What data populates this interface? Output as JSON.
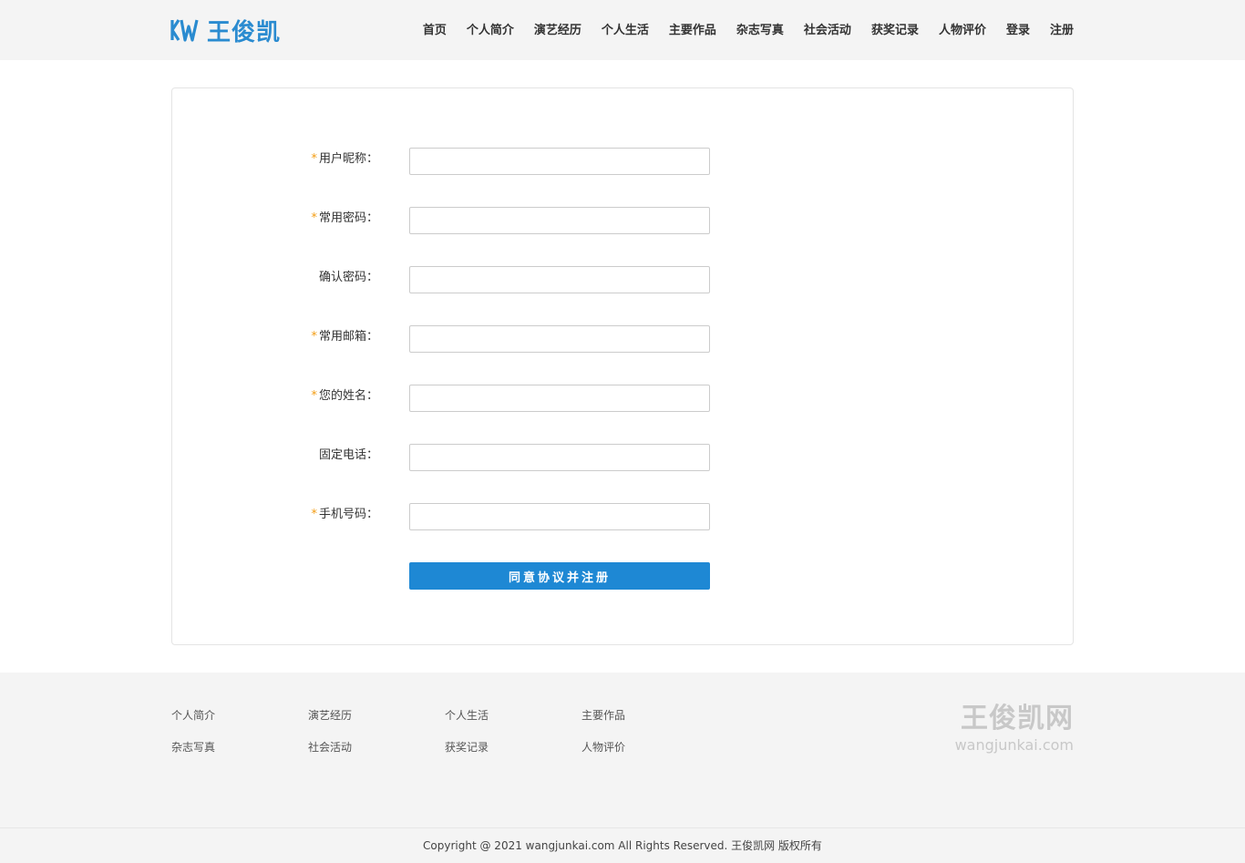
{
  "header": {
    "logo_text": "王俊凯",
    "nav": [
      "首页",
      "个人简介",
      "演艺经历",
      "个人生活",
      "主要作品",
      "杂志写真",
      "社会活动",
      "获奖记录",
      "人物评价",
      "登录",
      "注册"
    ]
  },
  "form": {
    "fields": [
      {
        "label": "用户昵称：",
        "required": true,
        "value": ""
      },
      {
        "label": "常用密码：",
        "required": true,
        "value": ""
      },
      {
        "label": "确认密码：",
        "required": false,
        "value": ""
      },
      {
        "label": "常用邮箱：",
        "required": true,
        "value": ""
      },
      {
        "label": "您的姓名：",
        "required": true,
        "value": ""
      },
      {
        "label": "固定电话：",
        "required": false,
        "value": ""
      },
      {
        "label": "手机号码：",
        "required": true,
        "value": ""
      }
    ],
    "required_mark": "*",
    "submit_label": "同意协议并注册"
  },
  "footer": {
    "links": [
      [
        "个人简介",
        "演艺经历",
        "个人生活",
        "主要作品"
      ],
      [
        "杂志写真",
        "社会活动",
        "获奖记录",
        "人物评价"
      ]
    ],
    "brand_cn": "王俊凯网",
    "brand_en": "wangjunkai.com",
    "copyright": "Copyright @ 2021 wangjunkai.com All Rights Reserved. 王俊凯网 版权所有"
  },
  "colors": {
    "accent": "#1e88d4",
    "required": "#f39c12",
    "header_bg": "#f4f4f4"
  }
}
